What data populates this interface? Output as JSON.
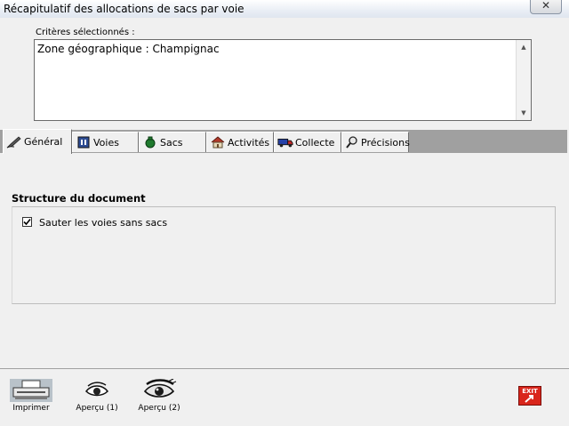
{
  "window": {
    "title": "Récapitulatif des allocations de sacs par voie",
    "close_label": "✕"
  },
  "criteria": {
    "label": "Critères sélectionnés :",
    "text": "Zone géographique : Champignac"
  },
  "tabs": [
    {
      "label": "Général",
      "icon": "pen-icon",
      "active": true
    },
    {
      "label": "Voies",
      "icon": "road-sign-icon",
      "active": false
    },
    {
      "label": "Sacs",
      "icon": "bag-icon",
      "active": false
    },
    {
      "label": "Activités",
      "icon": "house-icon",
      "active": false
    },
    {
      "label": "Collecte",
      "icon": "truck-icon",
      "active": false
    },
    {
      "label": "Précisions",
      "icon": "magnifier-icon",
      "active": false
    }
  ],
  "section": {
    "title": "Structure du document",
    "checkbox_label": "Sauter les voies sans sacs",
    "checkbox_checked": true
  },
  "toolbar": {
    "print_label": "Imprimer",
    "preview1_label": "Aperçu (1)",
    "preview2_label": "Aperçu (2)",
    "exit_label": "EXIT"
  },
  "colors": {
    "tabstrip": "#a0a0a0",
    "exit_red": "#d9261c"
  }
}
